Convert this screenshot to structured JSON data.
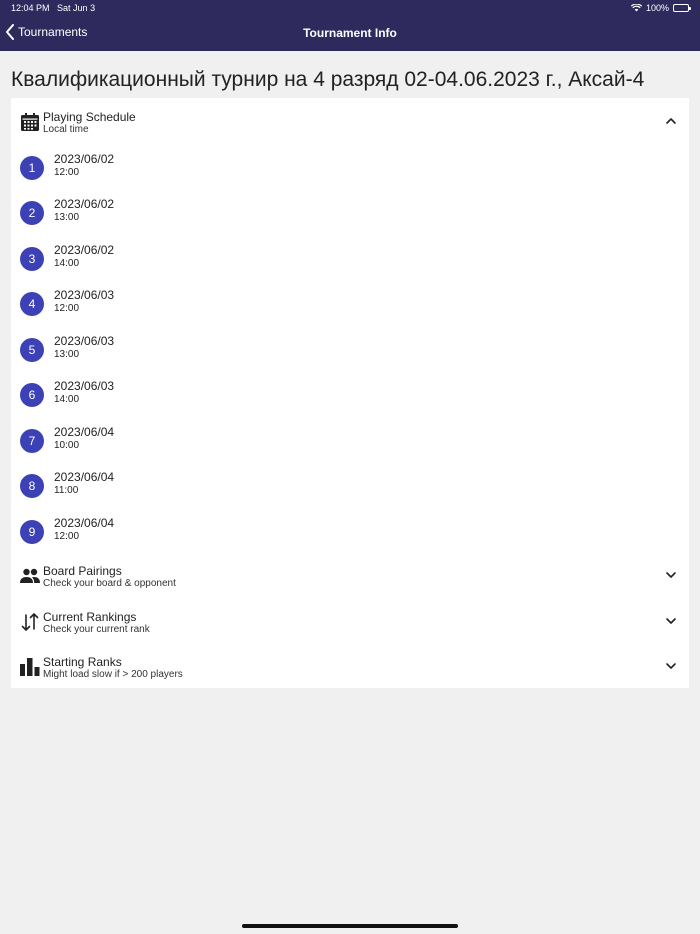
{
  "status_bar": {
    "time": "12:04 PM",
    "date": "Sat Jun 3",
    "battery": "100%"
  },
  "nav": {
    "back_label": "Tournaments",
    "title": "Tournament Info"
  },
  "page_title": "Квалификационный турнир на 4 разряд 02-04.06.2023 г., Аксай-4",
  "schedule": {
    "title": "Playing Schedule",
    "subtitle": "Local time",
    "icon": "calendar-icon",
    "expanded": true,
    "rounds": [
      {
        "number": "1",
        "date": "2023/06/02",
        "time": "12:00"
      },
      {
        "number": "2",
        "date": "2023/06/02",
        "time": "13:00"
      },
      {
        "number": "3",
        "date": "2023/06/02",
        "time": "14:00"
      },
      {
        "number": "4",
        "date": "2023/06/03",
        "time": "12:00"
      },
      {
        "number": "5",
        "date": "2023/06/03",
        "time": "13:00"
      },
      {
        "number": "6",
        "date": "2023/06/03",
        "time": "14:00"
      },
      {
        "number": "7",
        "date": "2023/06/04",
        "time": "10:00"
      },
      {
        "number": "8",
        "date": "2023/06/04",
        "time": "11:00"
      },
      {
        "number": "9",
        "date": "2023/06/04",
        "time": "12:00"
      }
    ]
  },
  "pairings": {
    "title": "Board Pairings",
    "subtitle": "Check your board & opponent",
    "icon": "people-icon"
  },
  "rankings": {
    "title": "Current Rankings",
    "subtitle": "Check your current rank",
    "icon": "sort-arrows-icon"
  },
  "starting": {
    "title": "Starting Ranks",
    "subtitle": "Might load slow if > 200 players",
    "icon": "bar-chart-icon"
  },
  "colors": {
    "nav_bg": "#2f2a5e",
    "badge": "#3d41b6",
    "page_bg": "#f0f0f0"
  }
}
